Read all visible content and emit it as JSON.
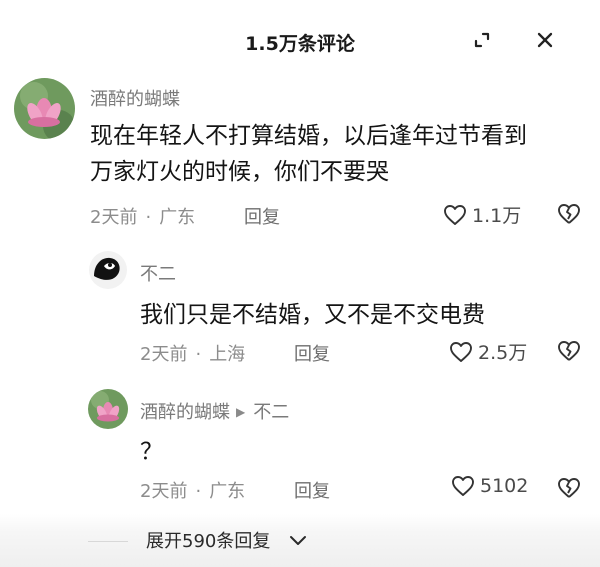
{
  "header": {
    "title": "1.5万条评论"
  },
  "comments": [
    {
      "username": "酒醉的蝴蝶",
      "text_line1": "现在年轻人不打算结婚，以后逢年过节看到",
      "text_line2": "万家灯火的时候，你们不要哭",
      "time": "2天前",
      "location": "广东",
      "reply_label": "回复",
      "likes": "1.1万"
    }
  ],
  "replies": [
    {
      "username": "不二",
      "text": "我们只是不结婚，又不是不交电费",
      "time": "2天前",
      "location": "上海",
      "reply_label": "回复",
      "likes": "2.5万"
    },
    {
      "username": "酒醉的蝴蝶",
      "reply_to": "不二",
      "text": "？",
      "time": "2天前",
      "location": "广东",
      "reply_label": "回复",
      "likes": "5102"
    }
  ],
  "expand": {
    "label": "展开590条回复"
  },
  "icons": {
    "expand": "expand-icon",
    "close": "close-icon",
    "like": "heart-icon",
    "dislike": "broken-heart-icon",
    "reply_to_arrow": "triangle-right-icon",
    "chevron": "chevron-down-icon"
  },
  "colors": {
    "text": "#141414",
    "muted": "#8c8c8c",
    "background": "#ffffff"
  }
}
